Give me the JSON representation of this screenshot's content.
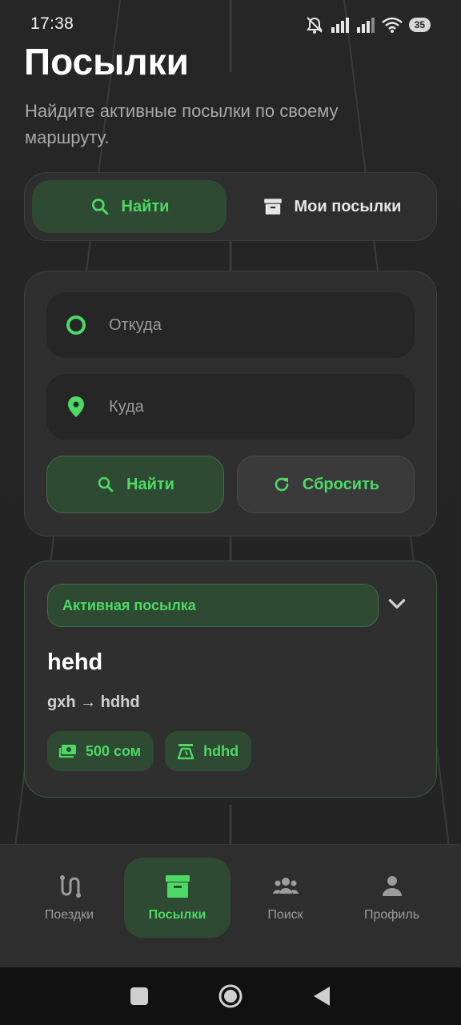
{
  "status_bar": {
    "time": "17:38",
    "battery": "35",
    "icons": [
      "mute-icon",
      "signal-icon",
      "signal-icon",
      "wifi-icon"
    ]
  },
  "header": {
    "title": "Посылки",
    "subtitle": "Найдите активные посылки по своему маршруту."
  },
  "tabs": [
    {
      "label": "Найти",
      "icon": "search-icon",
      "active": true
    },
    {
      "label": "Мои посылки",
      "icon": "archive-box-icon",
      "active": false
    }
  ],
  "search": {
    "from_placeholder": "Откуда",
    "to_placeholder": "Куда",
    "find_label": "Найти",
    "reset_label": "Сбросить"
  },
  "parcel": {
    "status": "Активная посылка",
    "title": "hehd",
    "route": "gxh → hdhd",
    "price": "500 сом",
    "weight": "hdhd"
  },
  "bottom_nav": [
    {
      "label": "Поездки",
      "icon": "route-icon",
      "active": false
    },
    {
      "label": "Посылки",
      "icon": "archive-box-icon",
      "active": true
    },
    {
      "label": "Поиск",
      "icon": "people-icon",
      "active": false
    },
    {
      "label": "Профиль",
      "icon": "person-icon",
      "active": false
    }
  ],
  "colors": {
    "accent": "#4cd964",
    "accent_bg": "#2f4a33",
    "background": "#232323",
    "card": "#2f2f2f"
  }
}
